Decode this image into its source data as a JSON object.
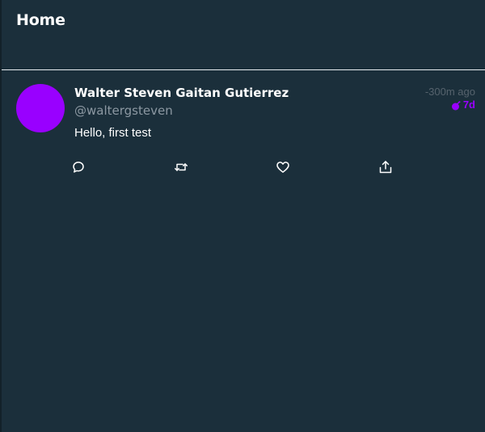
{
  "header": {
    "title": "Home"
  },
  "tweet": {
    "avatar_color": "#9900ff",
    "author_name": "Walter Steven Gaitan Gutierrez",
    "author_handle": "@waltergsteven",
    "text": "Hello, first test",
    "time_ago": "-300m ago",
    "expiry": "7d",
    "expiry_color": "#9900ff",
    "expiry_icon": "bomb-icon",
    "actions": [
      {
        "name": "reply",
        "icon": "comment-icon"
      },
      {
        "name": "retweet",
        "icon": "retweet-icon"
      },
      {
        "name": "like",
        "icon": "heart-icon"
      },
      {
        "name": "share",
        "icon": "share-icon"
      }
    ]
  },
  "colors": {
    "background": "#1b2f3b",
    "text": "#ffffff",
    "muted": "#8c98a2",
    "divider": "#e6ecf0"
  }
}
